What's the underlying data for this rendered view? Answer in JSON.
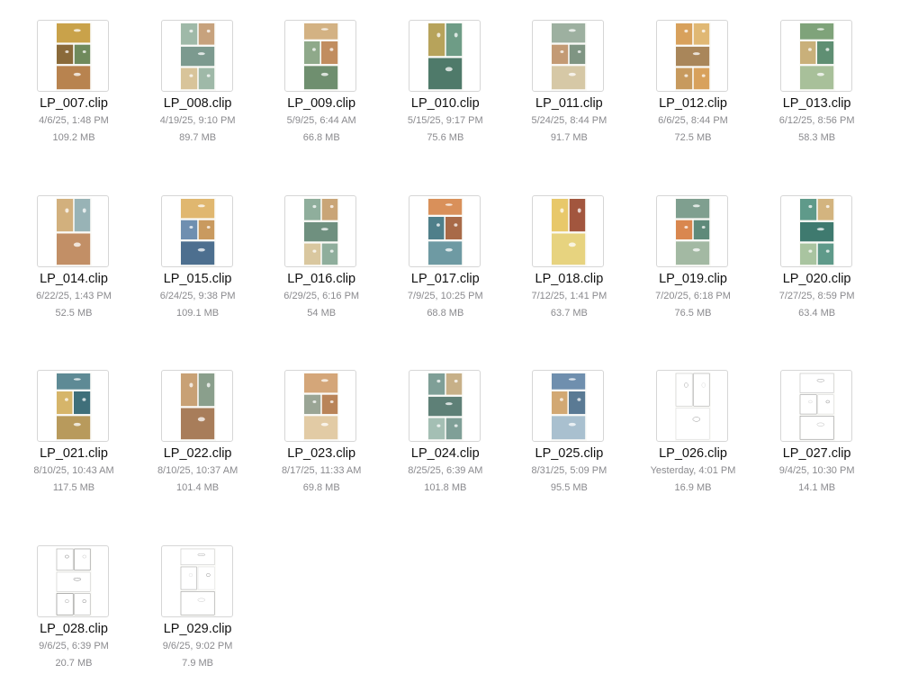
{
  "files": [
    {
      "name": "LP_007.clip",
      "date": "4/6/25, 1:48 PM",
      "size": "109.2 MB",
      "thumbnail": {
        "style": "color",
        "palette": [
          "#c9a24a",
          "#8a6a3a",
          "#6f8a5c",
          "#b8834f"
        ]
      }
    },
    {
      "name": "LP_008.clip",
      "date": "4/19/25, 9:10 PM",
      "size": "89.7 MB",
      "thumbnail": {
        "style": "color",
        "palette": [
          "#9fb9a8",
          "#c7a27d",
          "#7c9a8f",
          "#d8c49a"
        ]
      }
    },
    {
      "name": "LP_009.clip",
      "date": "5/9/25, 6:44 AM",
      "size": "66.8 MB",
      "thumbnail": {
        "style": "color",
        "palette": [
          "#d3b283",
          "#8fa98a",
          "#c18d5f",
          "#6f8f6f"
        ]
      }
    },
    {
      "name": "LP_010.clip",
      "date": "5/15/25, 9:17 PM",
      "size": "75.6 MB",
      "thumbnail": {
        "style": "color",
        "palette": [
          "#b7a35b",
          "#6e9c86",
          "#4f7a6a",
          "#a8b58c"
        ]
      }
    },
    {
      "name": "LP_011.clip",
      "date": "5/24/25, 8:44 PM",
      "size": "91.7 MB",
      "thumbnail": {
        "style": "color",
        "palette": [
          "#9db0a0",
          "#c39a74",
          "#7f9583",
          "#d6c8a6"
        ]
      }
    },
    {
      "name": "LP_012.clip",
      "date": "6/6/25, 8:44 PM",
      "size": "72.5 MB",
      "thumbnail": {
        "style": "color",
        "palette": [
          "#d8a15c",
          "#e0b874",
          "#a9865a",
          "#c79a5e"
        ]
      }
    },
    {
      "name": "LP_013.clip",
      "date": "6/12/25, 8:56 PM",
      "size": "58.3 MB",
      "thumbnail": {
        "style": "color",
        "palette": [
          "#7fa37a",
          "#c9b07a",
          "#5f8f73",
          "#a8c09a"
        ]
      }
    },
    {
      "name": "LP_014.clip",
      "date": "6/22/25, 1:43 PM",
      "size": "52.5 MB",
      "thumbnail": {
        "style": "color",
        "palette": [
          "#d2b07d",
          "#98b3b6",
          "#c28f66",
          "#e0cfa8"
        ]
      }
    },
    {
      "name": "LP_015.clip",
      "date": "6/24/25, 9:38 PM",
      "size": "109.1 MB",
      "thumbnail": {
        "style": "color",
        "palette": [
          "#e0b76f",
          "#6f8fb0",
          "#c99a5f",
          "#4d6f8f"
        ]
      }
    },
    {
      "name": "LP_016.clip",
      "date": "6/29/25, 6:16 PM",
      "size": "54 MB",
      "thumbnail": {
        "style": "color",
        "palette": [
          "#8fae9c",
          "#c9a577",
          "#6f907f",
          "#d9c79f"
        ]
      }
    },
    {
      "name": "LP_017.clip",
      "date": "7/9/25, 10:25 PM",
      "size": "68.8 MB",
      "thumbnail": {
        "style": "color",
        "palette": [
          "#d9905a",
          "#4f7f8a",
          "#a86a48",
          "#6e9aa3"
        ]
      }
    },
    {
      "name": "LP_018.clip",
      "date": "7/12/25, 1:41 PM",
      "size": "63.7 MB",
      "thumbnail": {
        "style": "color",
        "palette": [
          "#e8c86a",
          "#a2563e",
          "#e7d37f",
          "#7f9a6a"
        ]
      }
    },
    {
      "name": "LP_019.clip",
      "date": "7/20/25, 6:18 PM",
      "size": "76.5 MB",
      "thumbnail": {
        "style": "color",
        "palette": [
          "#7f9f8f",
          "#d9874f",
          "#5f8a7a",
          "#a3b9a3"
        ]
      }
    },
    {
      "name": "LP_020.clip",
      "date": "7/27/25, 8:59 PM",
      "size": "63.4 MB",
      "thumbnail": {
        "style": "color",
        "palette": [
          "#5f9a8a",
          "#d3b47f",
          "#3f7a6f",
          "#a9c4a0"
        ]
      }
    },
    {
      "name": "LP_021.clip",
      "date": "8/10/25, 10:43 AM",
      "size": "117.5 MB",
      "thumbnail": {
        "style": "color",
        "palette": [
          "#5e8a95",
          "#d6b56a",
          "#3f6f7a",
          "#b89a5c"
        ]
      }
    },
    {
      "name": "LP_022.clip",
      "date": "8/10/25, 10:37 AM",
      "size": "101.4 MB",
      "thumbnail": {
        "style": "color",
        "palette": [
          "#c8a175",
          "#8a9f8c",
          "#a87d5a",
          "#dac7a2"
        ]
      }
    },
    {
      "name": "LP_023.clip",
      "date": "8/17/25, 11:33 AM",
      "size": "69.8 MB",
      "thumbnail": {
        "style": "color",
        "palette": [
          "#d4a679",
          "#9aa595",
          "#b98459",
          "#e2cba5"
        ]
      }
    },
    {
      "name": "LP_024.clip",
      "date": "8/25/25, 6:39 AM",
      "size": "101.8 MB",
      "thumbnail": {
        "style": "color",
        "palette": [
          "#7f9f97",
          "#c7b088",
          "#5e8077",
          "#a4bfb4"
        ]
      }
    },
    {
      "name": "LP_025.clip",
      "date": "8/31/25, 5:09 PM",
      "size": "95.5 MB",
      "thumbnail": {
        "style": "color",
        "palette": [
          "#6f8fae",
          "#d2a873",
          "#5a7a94",
          "#a9c0cf"
        ]
      }
    },
    {
      "name": "LP_026.clip",
      "date": "Yesterday, 4:01 PM",
      "size": "16.9 MB",
      "thumbnail": {
        "style": "sketch",
        "palette": [
          "#bdbdbd",
          "#9a9a9a",
          "#d6d6d6",
          "#8a8a8a"
        ]
      }
    },
    {
      "name": "LP_027.clip",
      "date": "9/4/25, 10:30 PM",
      "size": "14.1 MB",
      "thumbnail": {
        "style": "sketch",
        "palette": [
          "#b5b5b5",
          "#8f8f8f",
          "#d0d0d0",
          "#7f7f7f"
        ]
      }
    },
    {
      "name": "LP_028.clip",
      "date": "9/6/25, 6:39 PM",
      "size": "20.7 MB",
      "thumbnail": {
        "style": "sketch",
        "palette": [
          "#9f9f9f",
          "#7a7a7a",
          "#c4c4c4",
          "#6a6a6a"
        ]
      }
    },
    {
      "name": "LP_029.clip",
      "date": "9/6/25, 9:02 PM",
      "size": "7.9 MB",
      "thumbnail": {
        "style": "sketch",
        "palette": [
          "#c2c2c2",
          "#a0a0a0",
          "#dcdcdc",
          "#8c8c8c"
        ]
      }
    }
  ]
}
